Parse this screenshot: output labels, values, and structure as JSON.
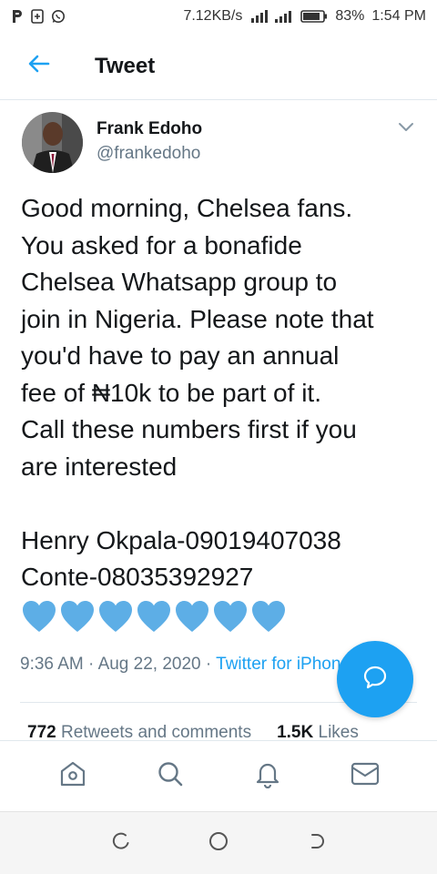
{
  "status_bar": {
    "speed": "7.12KB/s",
    "battery": "83%",
    "time": "1:54 PM",
    "left_icons": [
      "parking-icon",
      "shield-icon",
      "whatsapp-icon"
    ]
  },
  "header": {
    "title": "Tweet",
    "back_icon": "arrow-left-icon"
  },
  "tweet": {
    "author_name": "Frank Edoho",
    "author_handle": "@frankedoho",
    "text": "Good morning, Chelsea fans.\nYou asked for a bonafide\nChelsea Whatsapp group to\njoin in Nigeria. Please note that\nyou'd have to pay an annual\nfee of ₦10k to be part of it.\nCall these numbers first if you\nare interested\n\nHenry Okpala-09019407038\nConte-08035392927",
    "emoji_count": 7,
    "emoji": "blue-heart",
    "time": "9:36 AM",
    "date": "Aug 22, 2020",
    "source": "Twitter for iPhone",
    "retweets_count": "772",
    "retweets_label": "Retweets and comments",
    "likes_count": "1.5K",
    "likes_label": "Likes"
  },
  "tabs": [
    {
      "name": "home",
      "icon": "home-icon"
    },
    {
      "name": "search",
      "icon": "search-icon"
    },
    {
      "name": "notifications",
      "icon": "bell-icon"
    },
    {
      "name": "messages",
      "icon": "mail-icon"
    }
  ],
  "colors": {
    "accent": "#1da1f2",
    "text": "#14171a",
    "secondary": "#657786",
    "heart": "#5daee6"
  }
}
